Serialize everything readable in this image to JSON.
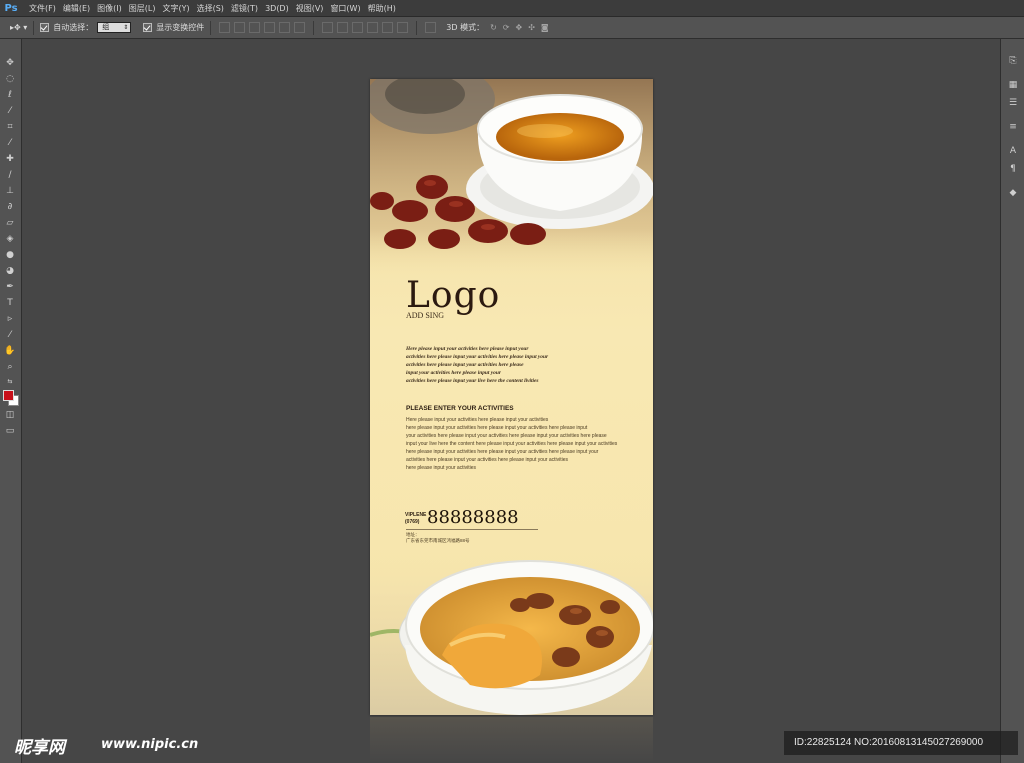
{
  "app": {
    "logo": "Ps"
  },
  "menu": [
    "文件(F)",
    "编辑(E)",
    "图像(I)",
    "图层(L)",
    "文字(Y)",
    "选择(S)",
    "滤镜(T)",
    "3D(D)",
    "视图(V)",
    "窗口(W)",
    "帮助(H)"
  ],
  "options": {
    "auto_select_label": "自动选择：",
    "auto_select_value": "组",
    "show_transform_label": "显示变换控件",
    "mode_3d_label": "3D 模式："
  },
  "colors": {
    "foreground": "#c8101a",
    "background": "#ffffff",
    "accent_ps": "#59aef7"
  },
  "tools": [
    "move-icon",
    "marquee-icon",
    "lasso-icon",
    "quick-select-icon",
    "crop-icon",
    "eyedropper-icon",
    "healing-icon",
    "brush-icon",
    "stamp-icon",
    "history-brush-icon",
    "eraser-icon",
    "gradient-icon",
    "blur-icon",
    "dodge-icon",
    "pen-icon",
    "type-icon",
    "path-select-icon",
    "line-icon",
    "hand-icon",
    "zoom-icon"
  ],
  "right_panel": [
    "history-icon",
    "properties-icon",
    "adjustments-icon",
    "character-icon",
    "paragraph-icon",
    "3d-icon"
  ],
  "document": {
    "logo_text": "Logo",
    "logo_sub": "ADD SING",
    "script_lines": [
      "Here please input your activities here please input your",
      "activities here please input your activities here please input your",
      "activities here please input your activities here please",
      "input your activities here please input your",
      "activities here please input your live here the content livities"
    ],
    "heading": "PLEASE ENTER YOUR ACTIVITIES",
    "body_lines": [
      "Here please input your activities here please input your activities",
      "here please input your activities here please input your activities here please input",
      "your activities here please input your activities here please input your activities here please",
      "input your live here the content here please input your activities here please input your activities",
      "here please input your activities here please input your activities here please input your",
      "activities here please input your activities here please input your activities",
      "here please input your activities"
    ],
    "vip_label": "VIPLENE",
    "area_code": "(0769)",
    "phone": "88888888",
    "addr_label": "地址：",
    "address": "广东省东莞市南城区鸿福路88号"
  },
  "watermark": {
    "logo": "昵享网",
    "site": "www.nipic.cn",
    "id": "ID:22825124 NO:20160813145027269000"
  }
}
